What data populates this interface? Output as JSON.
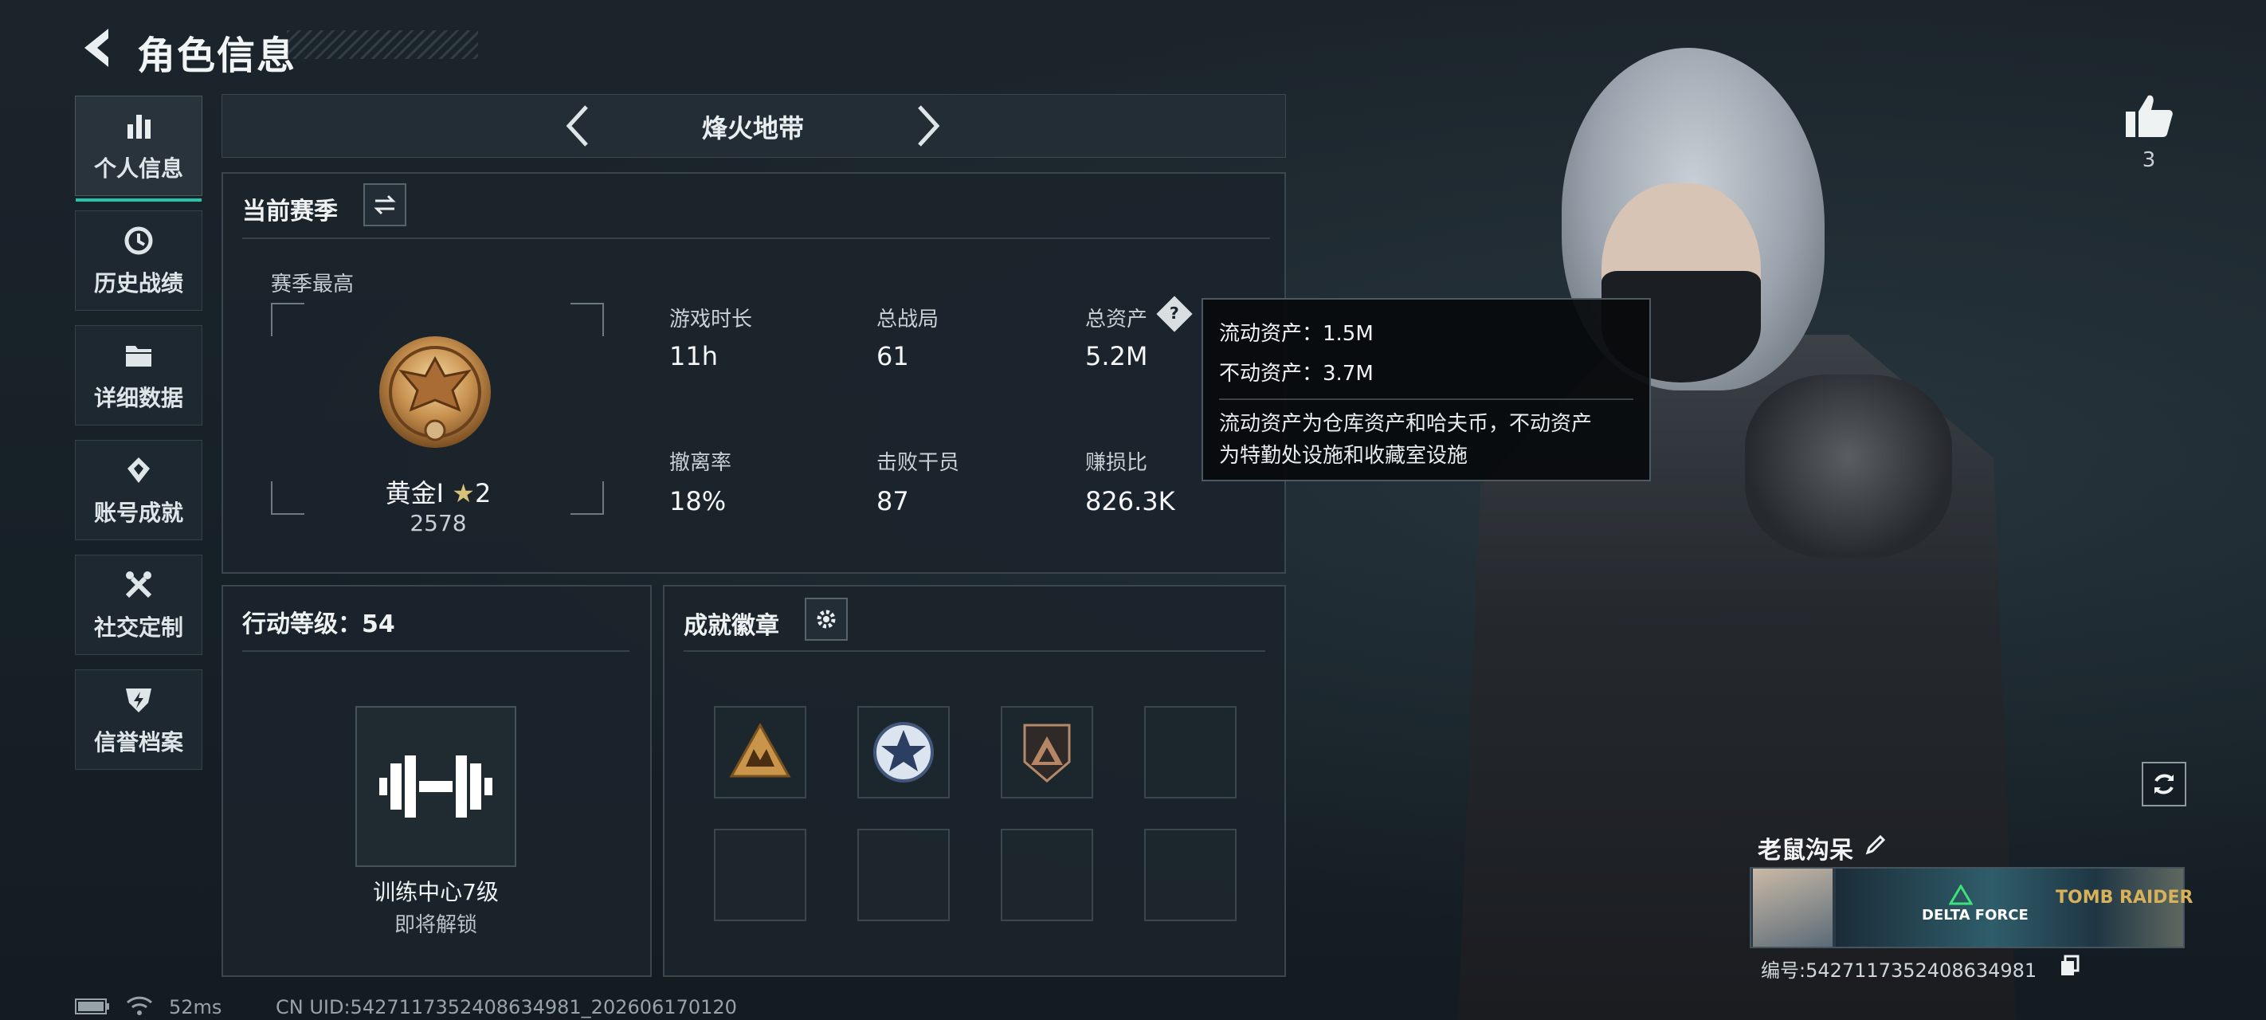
{
  "header": {
    "title": "角色信息"
  },
  "sidebar": {
    "items": [
      {
        "label": "个人信息",
        "icon": "bar-chart-icon",
        "active": true
      },
      {
        "label": "历史战绩",
        "icon": "clock-history-icon",
        "active": false
      },
      {
        "label": "详细数据",
        "icon": "folder-icon",
        "active": false
      },
      {
        "label": "账号成就",
        "icon": "medal-icon",
        "active": false
      },
      {
        "label": "社交定制",
        "icon": "tools-icon",
        "active": false
      },
      {
        "label": "信誉档案",
        "icon": "shield-lightning-icon",
        "active": false
      }
    ]
  },
  "mode": {
    "name": "烽火地带"
  },
  "season": {
    "title": "当前赛季",
    "best_label": "赛季最高",
    "rank_name": "黄金I",
    "rank_stars": "2",
    "rank_score": "2578",
    "stats": [
      {
        "label": "游戏时长",
        "value": "11h"
      },
      {
        "label": "总战局",
        "value": "61"
      },
      {
        "label": "总资产",
        "value": "5.2M"
      },
      {
        "label": "撤离率",
        "value": "18%"
      },
      {
        "label": "击败干员",
        "value": "87"
      },
      {
        "label": "赚损比",
        "value": "826.3K"
      }
    ]
  },
  "tooltip": {
    "liquid": "流动资产：1.5M",
    "fixed": "不动资产：3.7M",
    "desc1": "流动资产为仓库资产和哈夫币，不动资产",
    "desc2": "为特勤处设施和收藏室设施"
  },
  "action_level": {
    "title": "行动等级：54",
    "facility": "训练中心7级",
    "status": "即将解锁"
  },
  "badges": {
    "title": "成就徽章",
    "slots": [
      "gold-triangle-badge",
      "star-emblem-badge",
      "bronze-delta-badge",
      "",
      "",
      "",
      "",
      ""
    ]
  },
  "likes": {
    "count": "3"
  },
  "player": {
    "name": "老鼠沟呆",
    "id_label": "编号:542711735240863498​1",
    "brand_left": "DELTA FORCE",
    "brand_right": "TOMB RAIDER"
  },
  "status_bar": {
    "ping": "52ms",
    "uid": "CN UID:542711735240863498​1_202606170120"
  },
  "colors": {
    "accent": "#25c4a8",
    "panel_border": "#3a474f",
    "background": "#172027"
  }
}
